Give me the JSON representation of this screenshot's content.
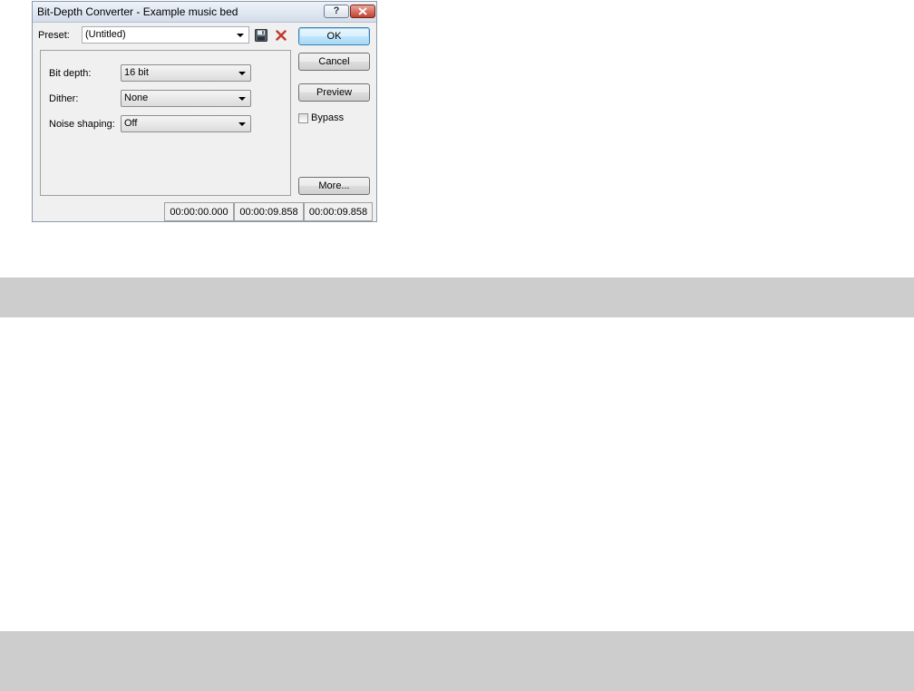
{
  "window": {
    "title": "Bit-Depth Converter - Example music bed",
    "help_button": "?",
    "close_button": "×"
  },
  "preset": {
    "label": "Preset:",
    "value": "(Untitled)",
    "save_icon": "floppy-disk-icon",
    "delete_icon": "red-x-icon"
  },
  "settings": {
    "bit_depth": {
      "label": "Bit depth:",
      "value": "16 bit"
    },
    "dither": {
      "label": "Dither:",
      "value": "None"
    },
    "noise_shaping": {
      "label": "Noise shaping:",
      "value": "Off"
    }
  },
  "buttons": {
    "ok": "OK",
    "cancel": "Cancel",
    "preview": "Preview",
    "more": "More..."
  },
  "bypass": {
    "label": "Bypass",
    "checked": false
  },
  "status": {
    "start": "00:00:00.000",
    "end": "00:00:09.858",
    "length": "00:00:09.858"
  },
  "colors": {
    "background_bands": "#cdcdcd",
    "dialog_face": "#f0f0f0",
    "close_red": "#c2412f",
    "default_button_blue": "#3c7fb1"
  }
}
